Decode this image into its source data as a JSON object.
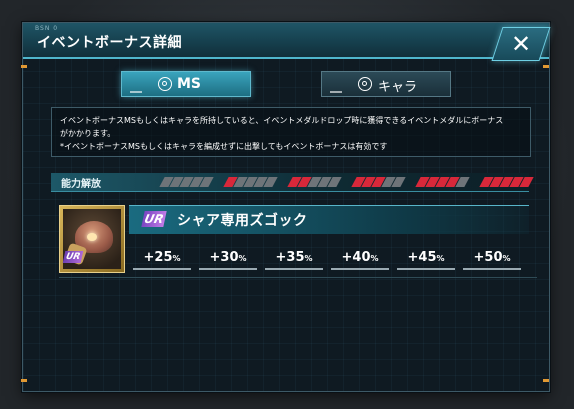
{
  "dialog": {
    "header_tag": "BSN 0",
    "title": "イベントボーナス詳細",
    "close_label": "✕"
  },
  "tabs": [
    {
      "label": "MS",
      "active": true
    },
    {
      "label": "キャラ",
      "active": false
    }
  ],
  "description": {
    "line1": "イベントボーナスMSもしくはキャラを所持していると、イベントメダルドロップ時に獲得できるイベントメダルにボーナス",
    "line2": "がかかります。",
    "line3": "*イベントボーナスMSもしくはキャラを編成せずに出撃してもイベントボーナスは有効です"
  },
  "ability_unlock": {
    "label": "能力解放",
    "levels": [
      {
        "filled": 0,
        "total": 5
      },
      {
        "filled": 1,
        "total": 5
      },
      {
        "filled": 2,
        "total": 5
      },
      {
        "filled": 3,
        "total": 5
      },
      {
        "filled": 4,
        "total": 5
      },
      {
        "filled": 5,
        "total": 5
      }
    ]
  },
  "unit": {
    "rarity": "UR",
    "name": "シャア専用ズゴック",
    "bonuses": [
      {
        "value": "+25",
        "unit": "%"
      },
      {
        "value": "+30",
        "unit": "%"
      },
      {
        "value": "+35",
        "unit": "%"
      },
      {
        "value": "+40",
        "unit": "%"
      },
      {
        "value": "+45",
        "unit": "%"
      },
      {
        "value": "+50",
        "unit": "%"
      }
    ]
  },
  "colors": {
    "accent": "#4fb6cc",
    "pip_filled": "#d8283a",
    "pip_empty": "#6e7479",
    "rarity": "#a05ad6"
  }
}
